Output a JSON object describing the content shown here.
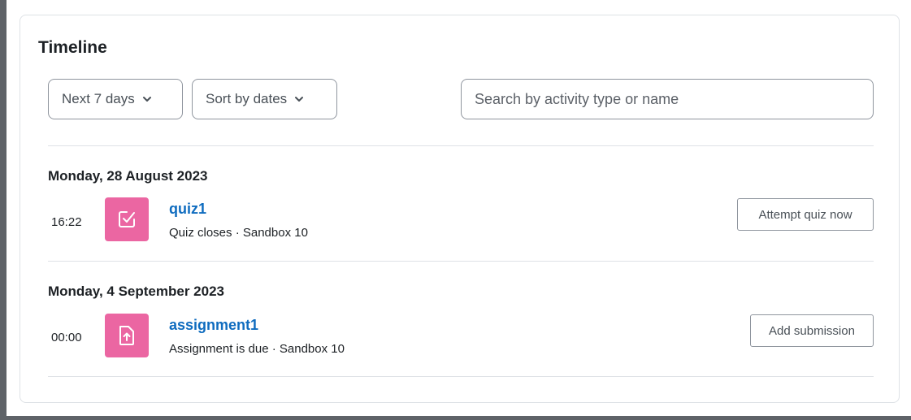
{
  "timeline": {
    "title": "Timeline",
    "filter_days": {
      "label": "Next 7 days",
      "icon": "chevron-down-icon"
    },
    "sort": {
      "label": "Sort by dates",
      "icon": "chevron-down-icon"
    },
    "search": {
      "placeholder": "Search by activity type or name",
      "value": ""
    },
    "groups": [
      {
        "date": "Monday, 28 August 2023",
        "events": [
          {
            "time": "16:22",
            "icon": "quiz-icon",
            "name": "quiz1",
            "meta": "Quiz closes · Sandbox 10",
            "action": "Attempt quiz now"
          }
        ]
      },
      {
        "date": "Monday, 4 September 2023",
        "events": [
          {
            "time": "00:00",
            "icon": "assignment-icon",
            "name": "assignment1",
            "meta": "Assignment is due · Sandbox 10",
            "action": "Add submission"
          }
        ]
      }
    ]
  },
  "colors": {
    "icon_background": "#eb66a2",
    "link": "#0f6cbf",
    "border": "#dee2e6",
    "frame": "#5f6368"
  }
}
